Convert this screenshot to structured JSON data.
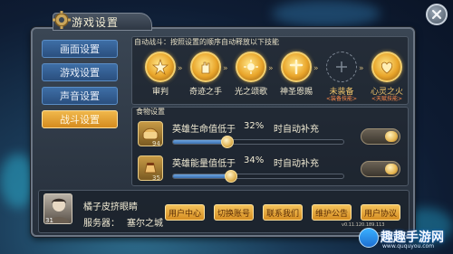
{
  "window": {
    "title": "游戏设置"
  },
  "side_tabs": [
    {
      "label": "画面设置",
      "active": false
    },
    {
      "label": "游戏设置",
      "active": false
    },
    {
      "label": "声音设置",
      "active": false
    },
    {
      "label": "战斗设置",
      "active": true
    }
  ],
  "auto_battle": {
    "hint": "自动战斗：按照设置的顺序自动释放以下技能",
    "skills": [
      {
        "label": "审判",
        "sub": "",
        "icon": "judgment-skill-icon",
        "locked": false
      },
      {
        "label": "奇迹之手",
        "sub": "",
        "icon": "hand-skill-icon",
        "locked": false
      },
      {
        "label": "光之颂歌",
        "sub": "",
        "icon": "light-skill-icon",
        "locked": false
      },
      {
        "label": "神圣恩赐",
        "sub": "",
        "icon": "holy-skill-icon",
        "locked": false
      },
      {
        "label": "未装备",
        "sub": "<装备技能>",
        "icon": "empty-slot-icon",
        "locked": true
      },
      {
        "label": "心灵之火",
        "sub": "<天赋技能>",
        "icon": "heart-fire-skill-icon",
        "locked": false
      }
    ]
  },
  "food": {
    "title": "食物设置",
    "rows": [
      {
        "text": "英雄生命值低于",
        "percent": "32%",
        "suffix": "时自动补充",
        "count": "94",
        "level": 0.32,
        "enabled": true
      },
      {
        "text": "英雄能量值低于",
        "percent": "34%",
        "suffix": "时自动补充",
        "count": "35",
        "level": 0.34,
        "enabled": true
      }
    ]
  },
  "player": {
    "name": "橘子皮挤眼睛",
    "level": "31",
    "server_label": "服务器：",
    "server_name": "塞尔之城"
  },
  "buttons": [
    "用户中心",
    "切换账号",
    "联系我们",
    "维护公告",
    "用户协议"
  ],
  "version": "v0.11.120.189.113",
  "watermark": {
    "text": "趣趣手游网",
    "url": "www.ququyou.com"
  },
  "colors": {
    "accent": "#e9a52a",
    "active_tab": "#f0b84c",
    "tab": "#3e6ea6"
  }
}
